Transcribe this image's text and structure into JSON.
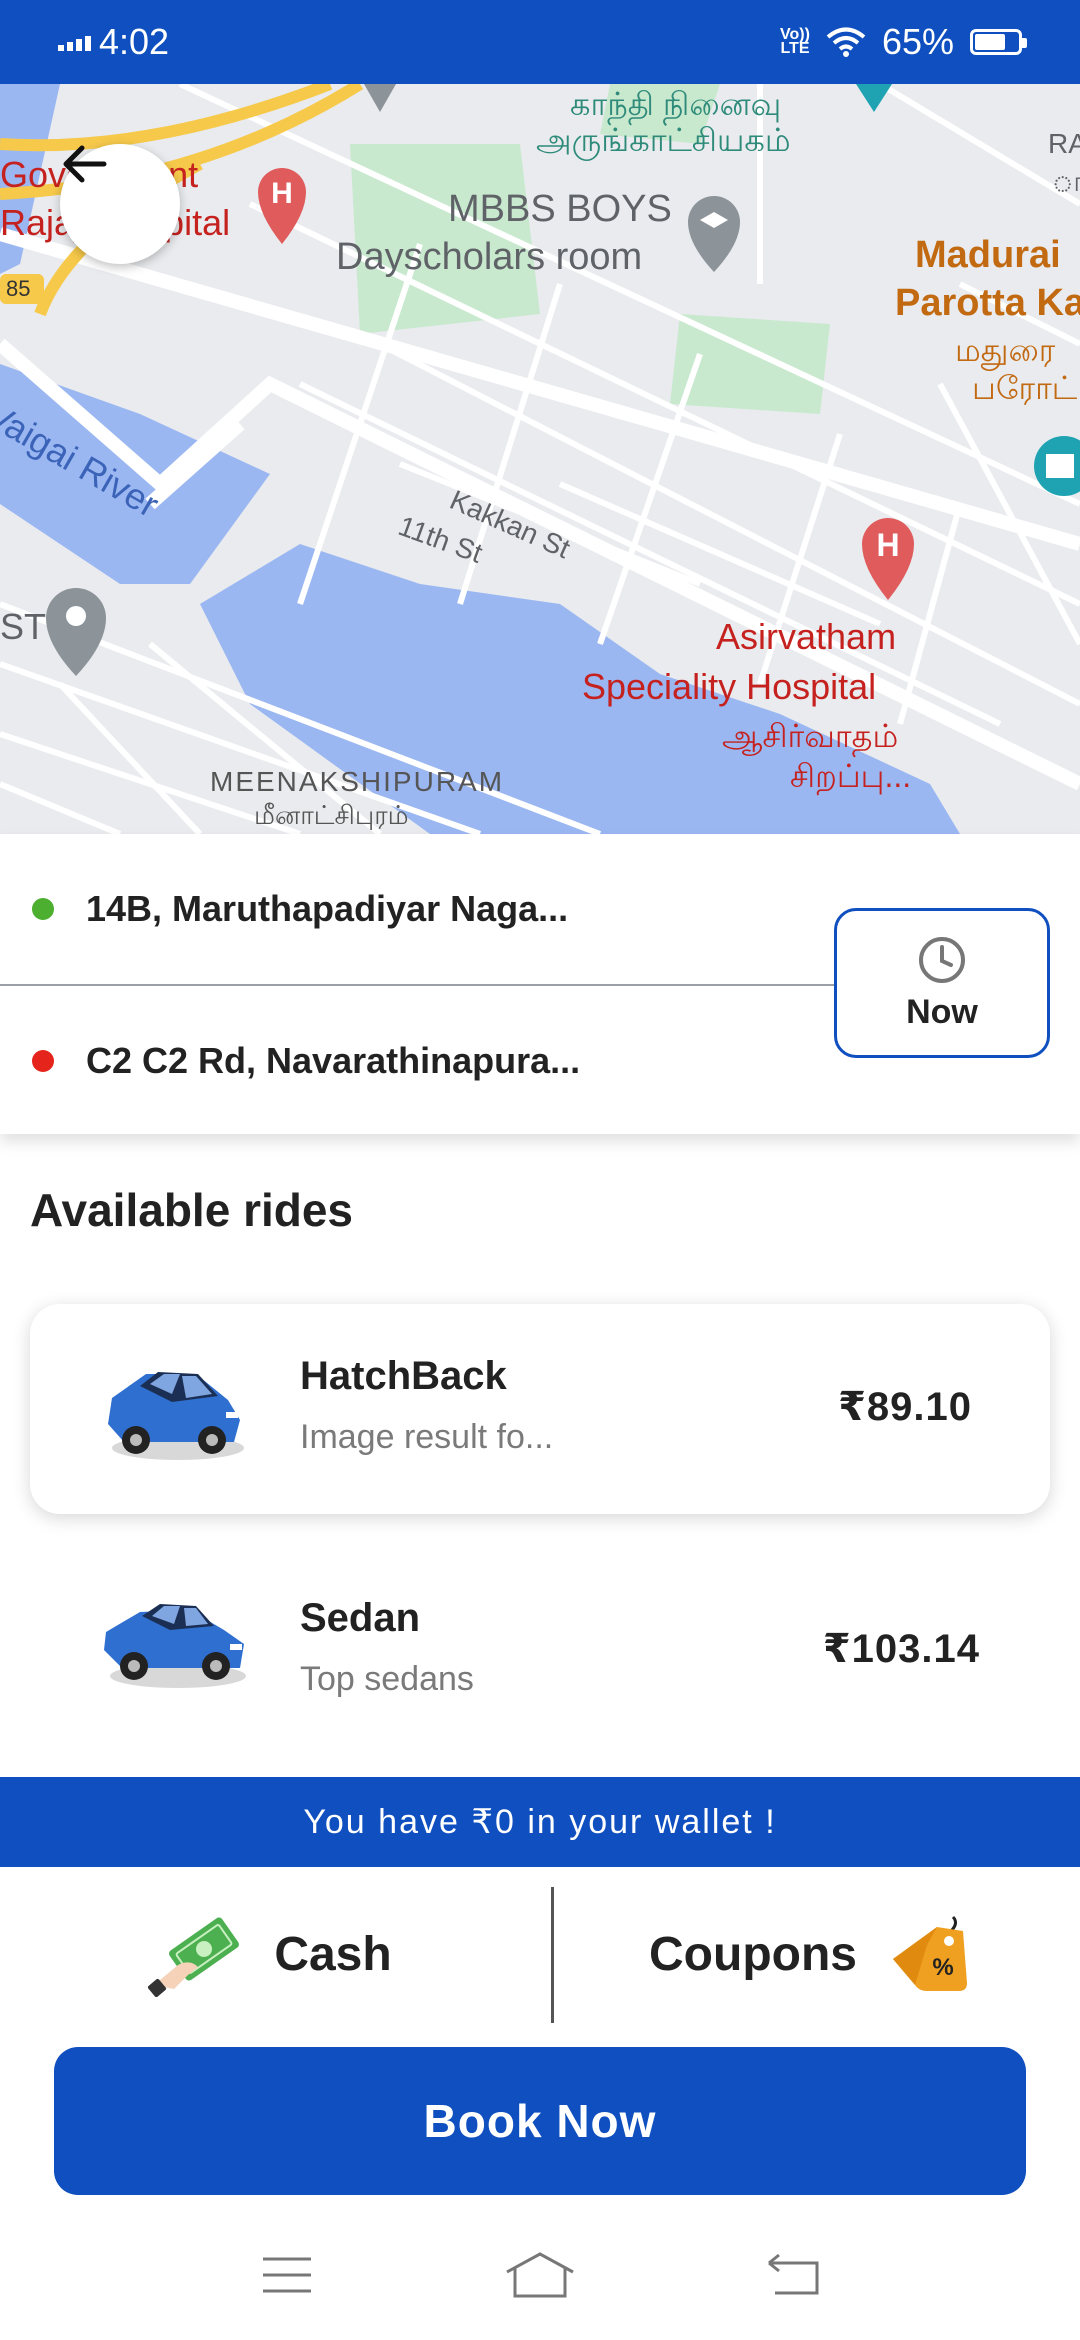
{
  "status_bar": {
    "time": "4:02",
    "network": "LTE",
    "battery_percent": "65%",
    "battery_level": 0.65
  },
  "map": {
    "labels": {
      "memorial_tamil_1": "காந்தி நினைவு",
      "memorial_tamil_2": "அருங்காட்சியகம்",
      "mbbs_line1": "MBBS BOYS",
      "mbbs_line2": "Dayscholars room",
      "govt_line1": "Government",
      "govt_line2": "Rajaji Hospital",
      "route_badge": "85",
      "parotta_line1": "Madurai",
      "parotta_line2": "Parotta Ka",
      "parotta_tamil_1": "மதுரை",
      "parotta_tamil_2": "பரோட்",
      "ra": "RA",
      "ra_tamil": "ாா",
      "kakkan": "Kakkan St",
      "eleventh": "11th St",
      "river": "Vaigai River",
      "st": "ST",
      "hospital_line1": "Asirvatham",
      "hospital_line2": "Speciality Hospital",
      "hospital_tamil_1": "ஆசிர்வாதம்",
      "hospital_tamil_2": "சிறப்பு...",
      "locality": "MEENAKSHIPURAM",
      "locality_tamil": "மீனாட்சிபுரம்"
    }
  },
  "route": {
    "pickup": "14B, Maruthapadiyar Naga...",
    "drop": "C2 C2 Rd, Navarathinapura...",
    "pickup_color": "#4caf2f",
    "drop_color": "#e5251b",
    "time_button": "Now"
  },
  "rides": {
    "title": "Available rides",
    "items": [
      {
        "name": "HatchBack",
        "desc": "Image result fo...",
        "price": "₹89.10",
        "selected": true
      },
      {
        "name": "Sedan",
        "desc": "Top sedans",
        "price": "₹103.14",
        "selected": false
      }
    ]
  },
  "wallet": {
    "message": "You have ₹0 in your wallet !"
  },
  "payment": {
    "cash_label": "Cash",
    "coupons_label": "Coupons"
  },
  "book": {
    "label": "Book Now"
  },
  "colors": {
    "primary": "#0f4fbf",
    "map_water": "#9bb7f2",
    "map_park": "#c9e9cf"
  }
}
